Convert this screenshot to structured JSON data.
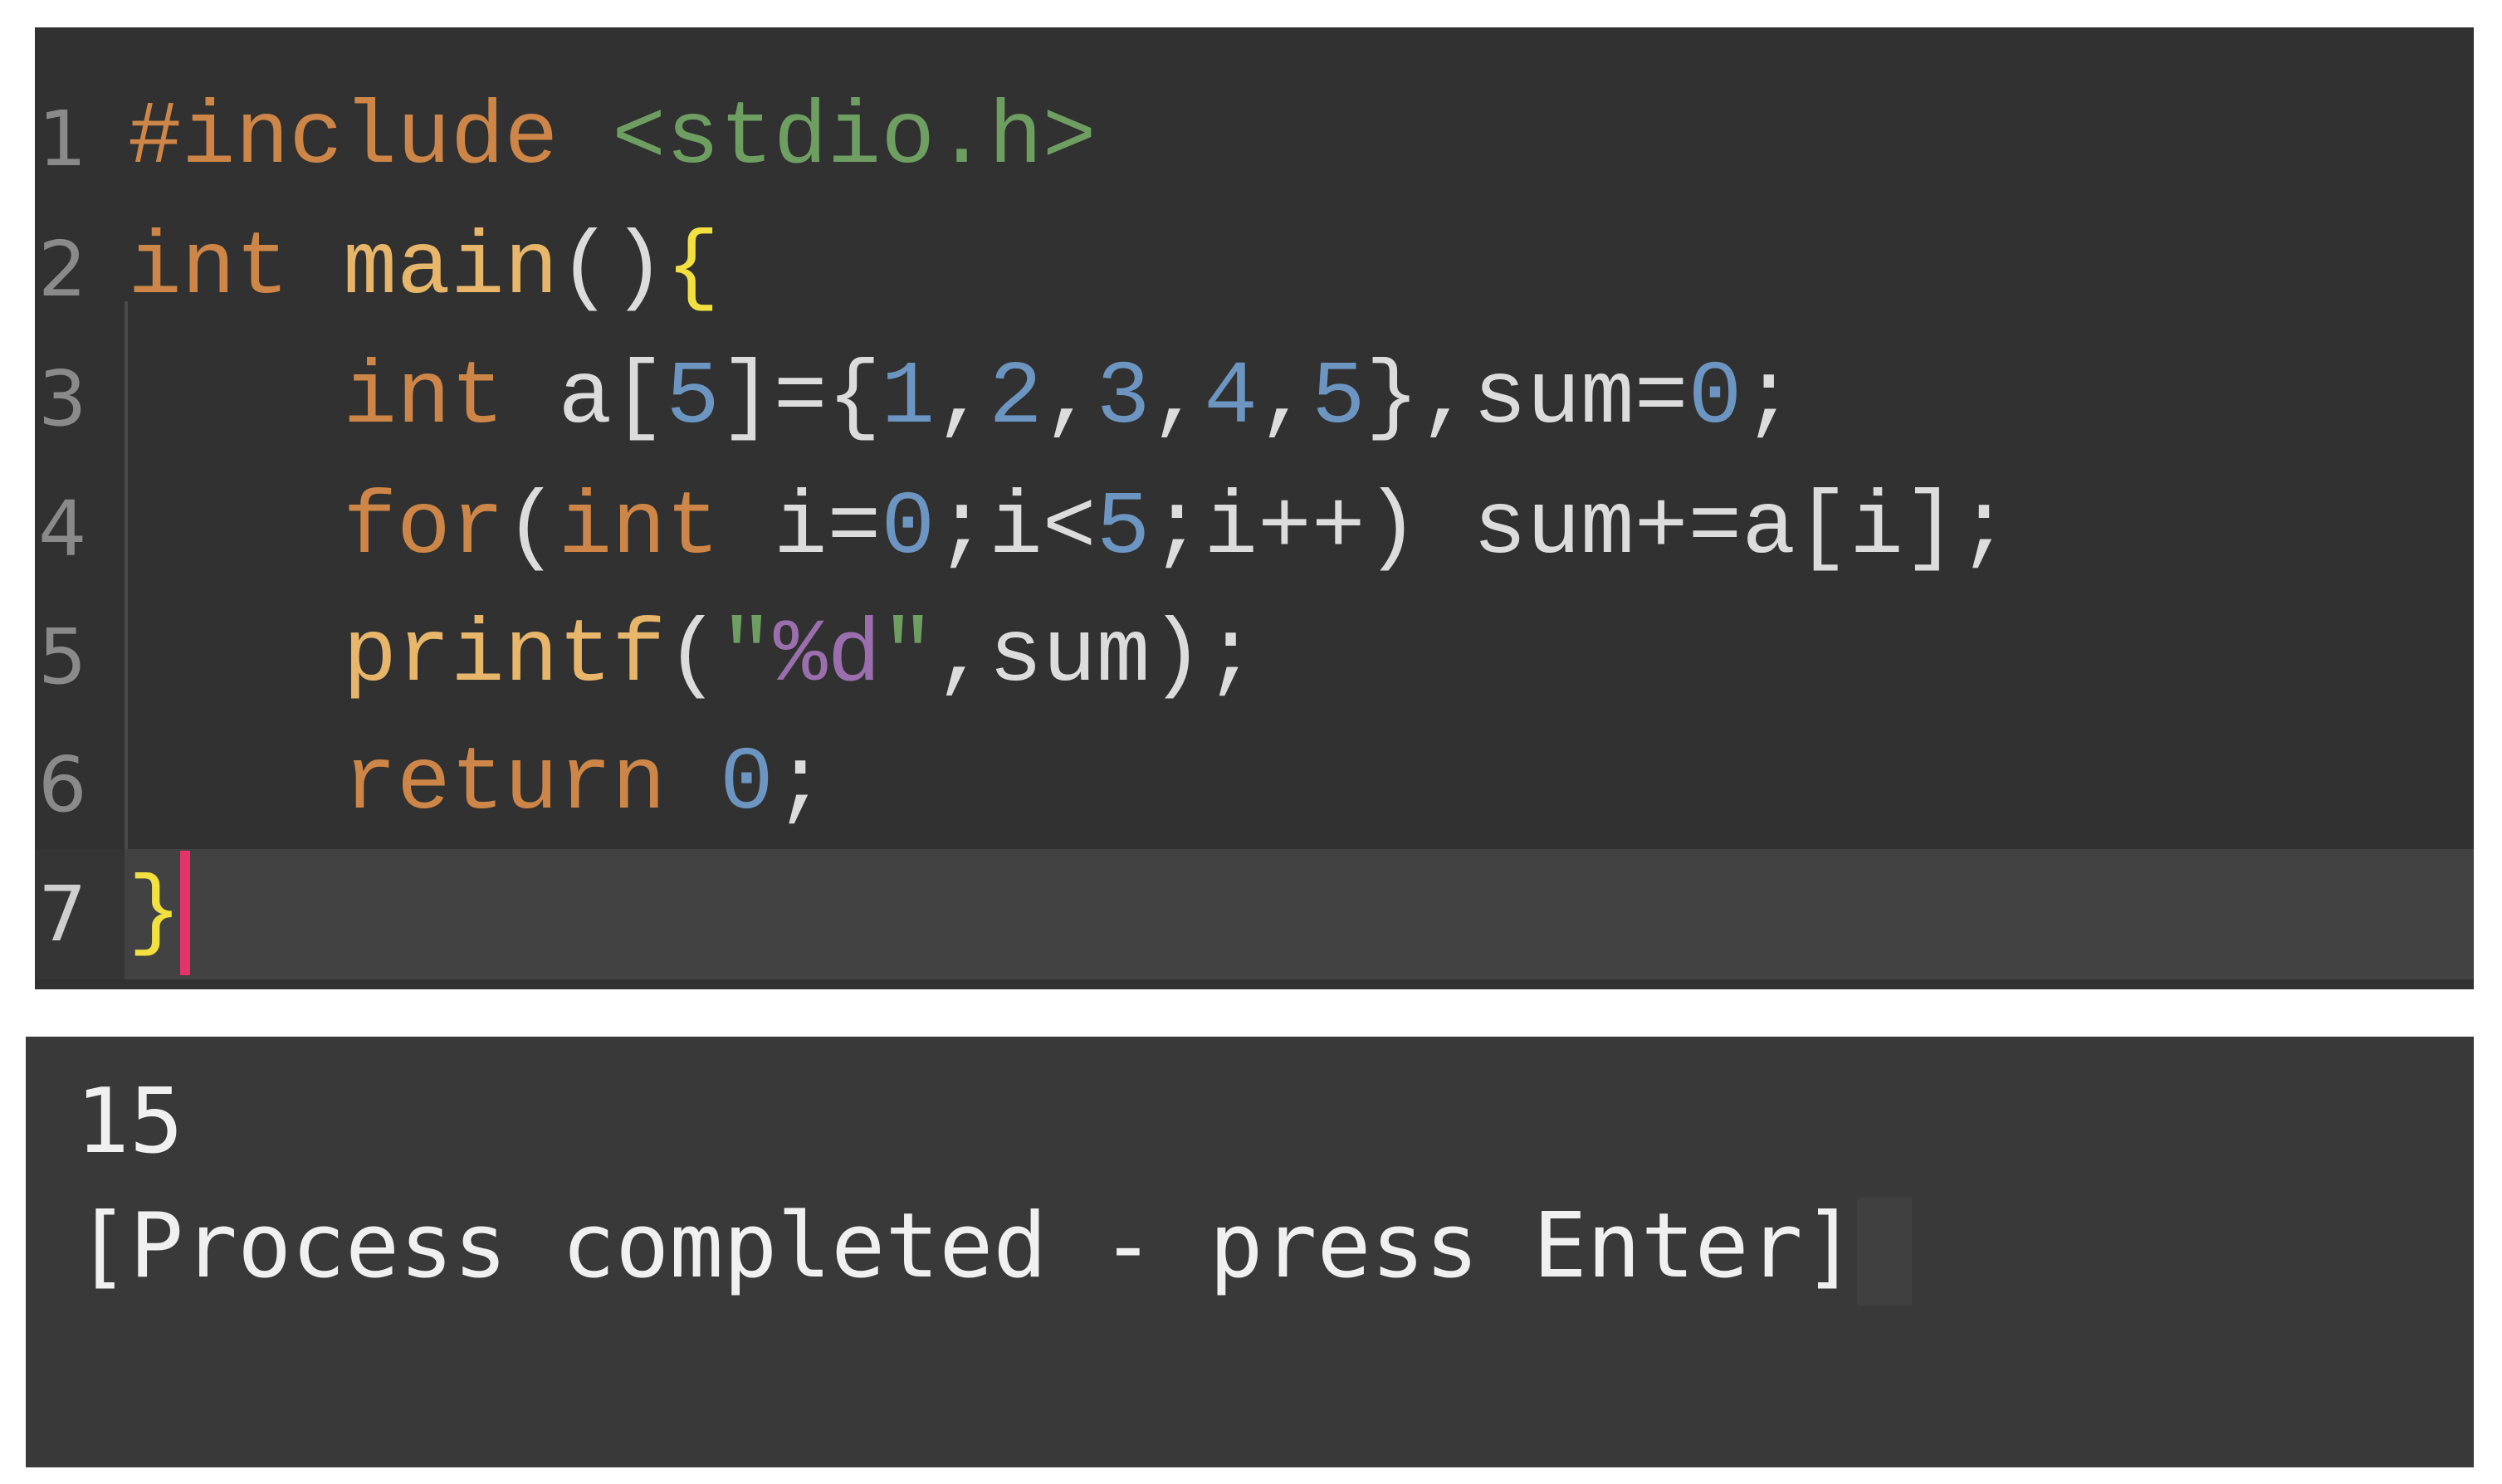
{
  "editor": {
    "current_line": 7,
    "colors": {
      "kw": "#cd8647",
      "str": "#6e9e62",
      "num": "#6c95c2",
      "fn": "#e8b66a",
      "brace": "#f2e040",
      "fmt": "#9b6fae",
      "cursor": "#e8336a"
    },
    "lines": [
      {
        "num": "1",
        "tokens": [
          [
            "kw",
            "#include"
          ],
          [
            "plain",
            " "
          ],
          [
            "str",
            "<stdio.h>"
          ]
        ]
      },
      {
        "num": "2",
        "tokens": [
          [
            "kw",
            "int"
          ],
          [
            "plain",
            " "
          ],
          [
            "fn",
            "main"
          ],
          [
            "plain",
            "()"
          ],
          [
            "brace",
            "{"
          ]
        ]
      },
      {
        "num": "3",
        "tokens": [
          [
            "plain",
            "    "
          ],
          [
            "kw",
            "int"
          ],
          [
            "plain",
            " a["
          ],
          [
            "num",
            "5"
          ],
          [
            "plain",
            "]={"
          ],
          [
            "num",
            "1"
          ],
          [
            "plain",
            ","
          ],
          [
            "num",
            "2"
          ],
          [
            "plain",
            ","
          ],
          [
            "num",
            "3"
          ],
          [
            "plain",
            ","
          ],
          [
            "num",
            "4"
          ],
          [
            "plain",
            ","
          ],
          [
            "num",
            "5"
          ],
          [
            "plain",
            "},sum="
          ],
          [
            "num",
            "0"
          ],
          [
            "plain",
            ";"
          ]
        ]
      },
      {
        "num": "4",
        "tokens": [
          [
            "plain",
            "    "
          ],
          [
            "kw",
            "for"
          ],
          [
            "plain",
            "("
          ],
          [
            "kw",
            "int"
          ],
          [
            "plain",
            " i="
          ],
          [
            "num",
            "0"
          ],
          [
            "plain",
            ";i<"
          ],
          [
            "num",
            "5"
          ],
          [
            "plain",
            ";i++) sum+=a[i];"
          ]
        ]
      },
      {
        "num": "5",
        "tokens": [
          [
            "plain",
            "    "
          ],
          [
            "fn",
            "printf"
          ],
          [
            "plain",
            "("
          ],
          [
            "str",
            "\""
          ],
          [
            "fmt",
            "%d"
          ],
          [
            "str",
            "\""
          ],
          [
            "plain",
            ",sum);"
          ]
        ]
      },
      {
        "num": "6",
        "tokens": [
          [
            "plain",
            "    "
          ],
          [
            "kw",
            "return"
          ],
          [
            "plain",
            " "
          ],
          [
            "num",
            "0"
          ],
          [
            "plain",
            ";"
          ]
        ]
      },
      {
        "num": "7",
        "tokens": [
          [
            "brace",
            "}"
          ]
        ]
      }
    ]
  },
  "terminal": {
    "output": "15",
    "status": "[Process completed - press Enter]"
  }
}
